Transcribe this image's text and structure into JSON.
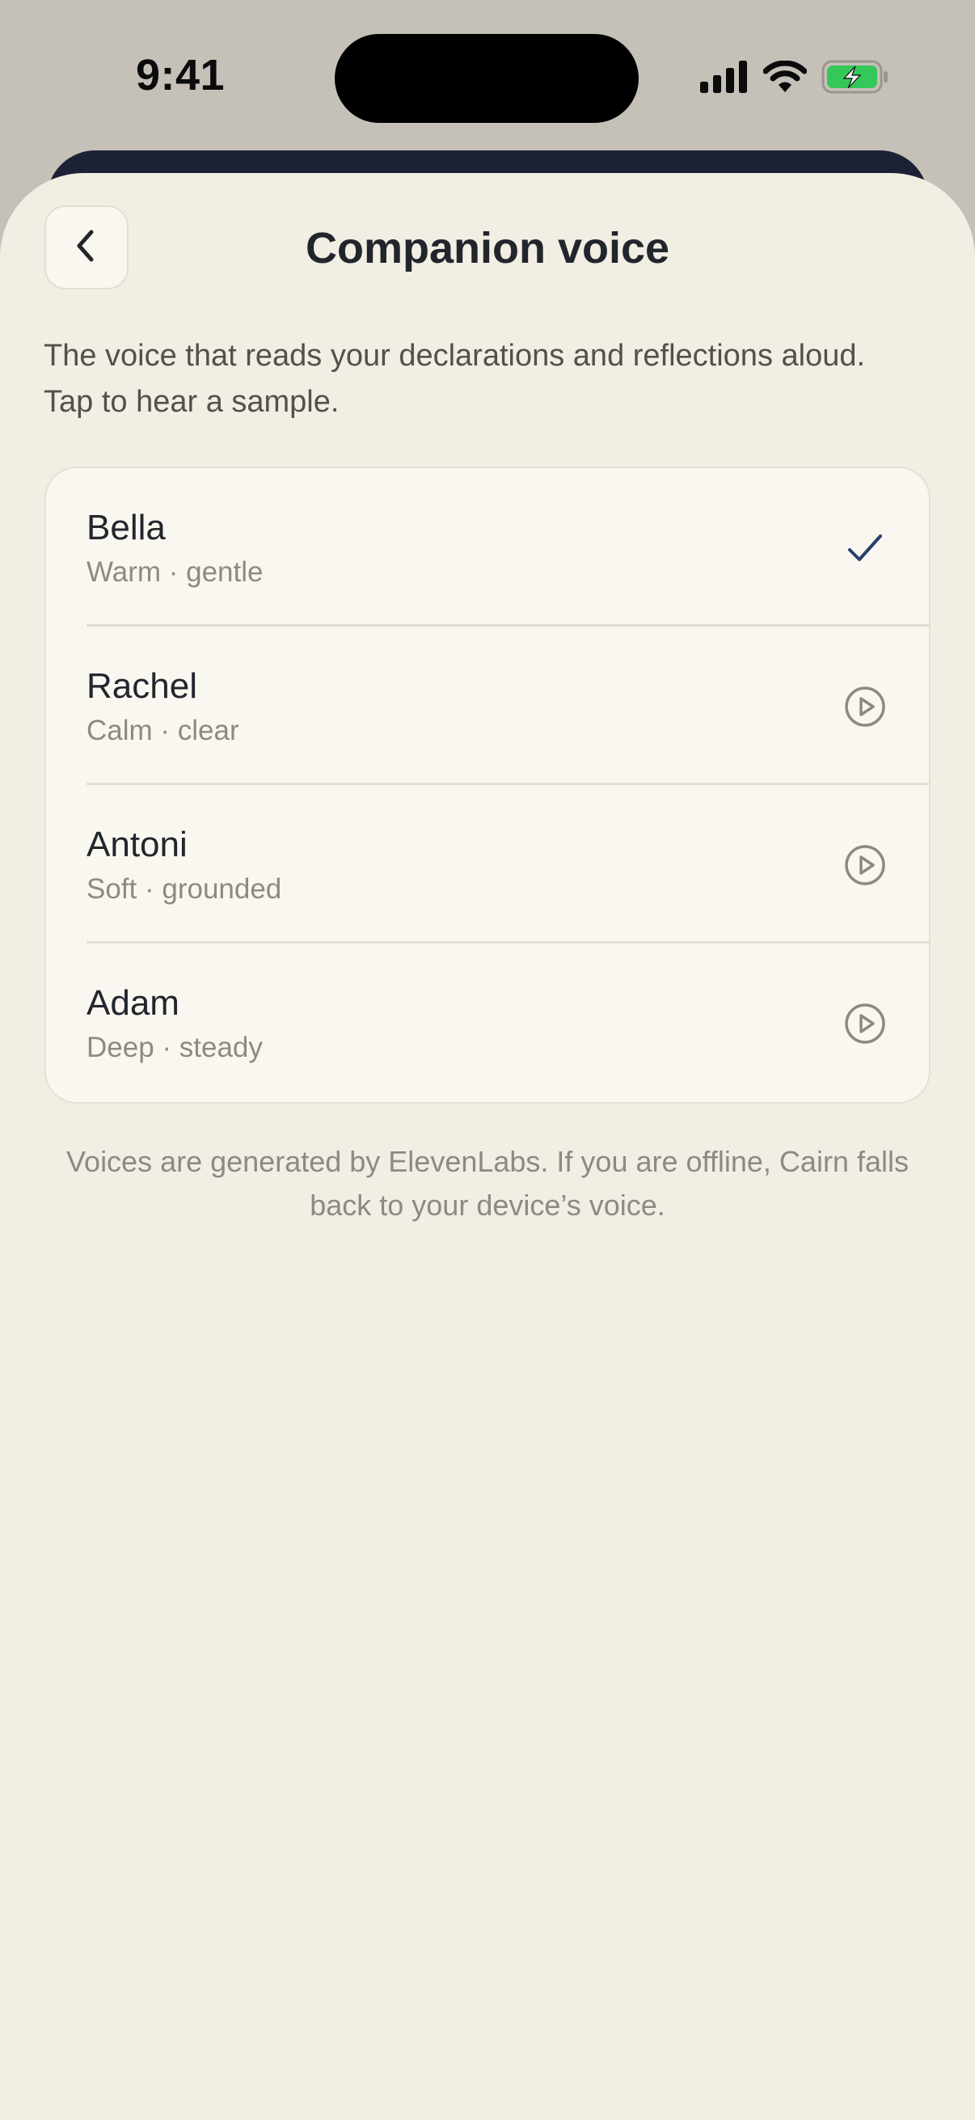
{
  "status_bar": {
    "time": "9:41",
    "icons": [
      "cellular-signal-icon",
      "wifi-icon",
      "battery-charging-icon"
    ],
    "battery_color": "#34C759"
  },
  "header": {
    "back_icon": "chevron-left-icon",
    "title": "Companion voice"
  },
  "intro": "The voice that reads your declarations and reflections aloud. Tap to hear a sample.",
  "voices": [
    {
      "name": "Bella",
      "description": "Warm · gentle",
      "selected": true,
      "icon": "checkmark-icon"
    },
    {
      "name": "Rachel",
      "description": "Calm · clear",
      "selected": false,
      "icon": "play-circle-icon"
    },
    {
      "name": "Antoni",
      "description": "Soft · grounded",
      "selected": false,
      "icon": "play-circle-icon"
    },
    {
      "name": "Adam",
      "description": "Deep · steady",
      "selected": false,
      "icon": "play-circle-icon"
    }
  ],
  "footer": "Voices are generated by ElevenLabs. If you are offline, Cairn falls back to your device’s voice.",
  "colors": {
    "accent": "#27406B",
    "sheet_background": "#F2EEE4",
    "card_background": "#FAF7F0"
  }
}
